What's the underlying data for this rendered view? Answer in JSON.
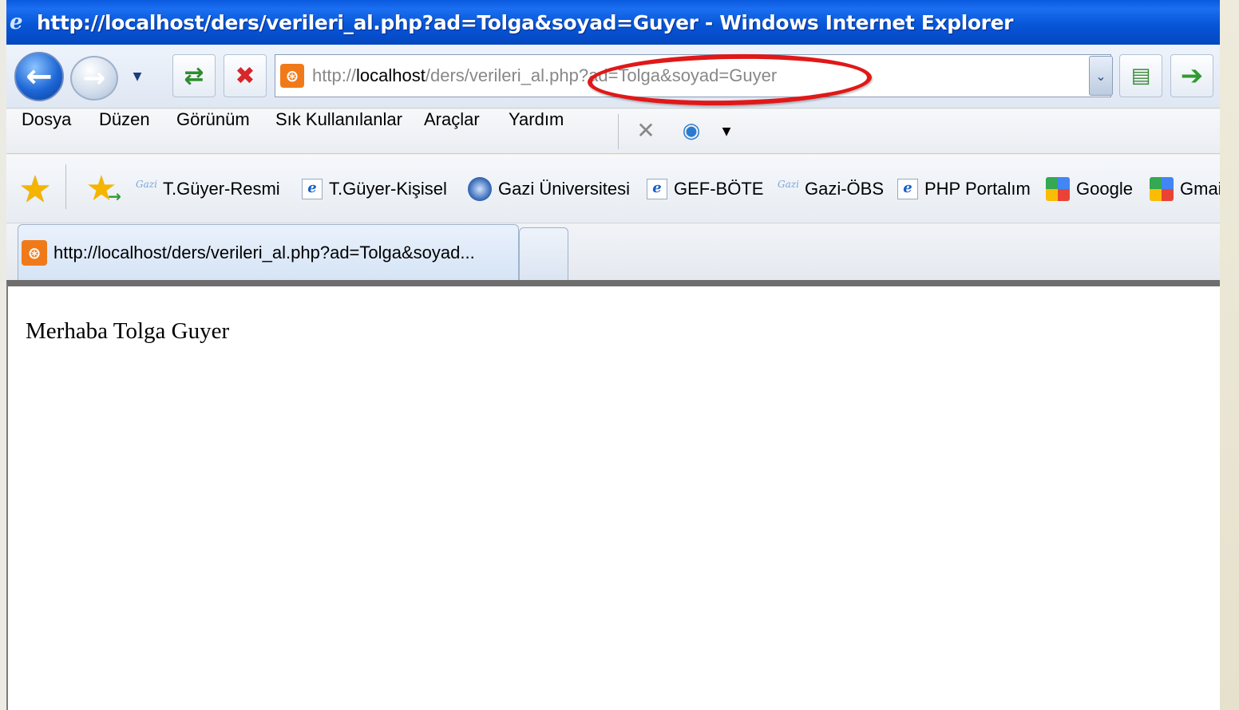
{
  "window": {
    "title": "http://localhost/ders/verileri_al.php?ad=Tolga&soyad=Guyer - Windows Internet Explorer"
  },
  "navigation": {
    "back_icon": "back-arrow-icon",
    "forward_icon": "forward-arrow-icon",
    "refresh_icon": "refresh-icon",
    "stop_icon": "stop-icon",
    "go_icon": "go-arrow-icon",
    "compatibility_icon": "compatibility-view-icon"
  },
  "address_bar": {
    "scheme": "http://",
    "host": "localhost",
    "path": "/ders/verileri_al.php?ad=Tolga&soyad=Guyer",
    "highlight_color": "#e01818"
  },
  "menu": {
    "items": [
      "Dosya",
      "Düzen",
      "Görünüm",
      "Sık Kullanılanlar",
      "Araçlar",
      "Yardım"
    ]
  },
  "favorites": {
    "links": [
      {
        "label": "T.Güyer-Resmi",
        "icon": "gazi-icon"
      },
      {
        "label": "T.Güyer-Kişisel",
        "icon": "ie-page-icon"
      },
      {
        "label": "Gazi Üniversitesi",
        "icon": "globe-icon"
      },
      {
        "label": "GEF-BÖTE",
        "icon": "ie-page-icon"
      },
      {
        "label": "Gazi-ÖBS",
        "icon": "gazi-icon"
      },
      {
        "label": "PHP Portalım",
        "icon": "ie-page-icon"
      },
      {
        "label": "Google",
        "icon": "google-icon"
      },
      {
        "label": "Gmai",
        "icon": "google-icon"
      }
    ]
  },
  "tabs": {
    "active_label": "http://localhost/ders/verileri_al.php?ad=Tolga&soyad..."
  },
  "page": {
    "body_text": "Merhaba Tolga Guyer"
  }
}
